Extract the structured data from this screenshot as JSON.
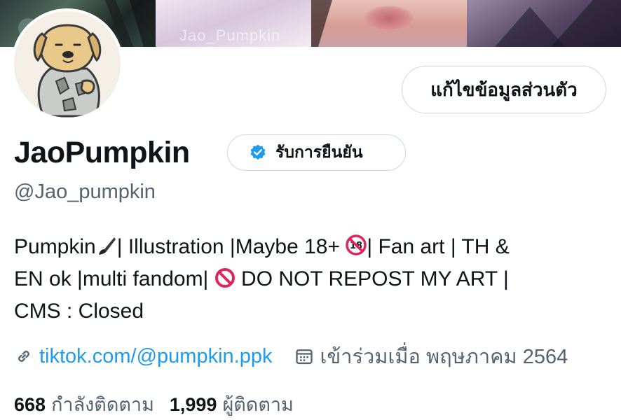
{
  "banner": {
    "watermark": "Jao_Pumpkin"
  },
  "profile": {
    "edit_button": "แก้ไขข้อมูลส่วนตัว",
    "name": "JaoPumpkin",
    "verified_label": "รับการยืนยัน",
    "handle": "@Jao_pumpkin",
    "bio": {
      "line1_a": "Pumpkin",
      "line1_b": "| Illustration |Maybe 18+",
      "line1_c": "| Fan art | TH &",
      "line2_a": "EN ok |multi fandom|",
      "line2_b": "DO NOT REPOST MY ART |",
      "line3": "CMS : Closed"
    },
    "link": "tiktok.com/@pumpkin.ppk",
    "joined": "เข้าร่วมเมื่อ พฤษภาคม 2564",
    "following_count": "668",
    "following_label": "กำลังติดตาม",
    "followers_count": "1,999",
    "followers_label": "ผู้ติดตาม"
  },
  "colors": {
    "link": "#1d9bf0",
    "verified": "#1d9bf0",
    "secondary_text": "#536471",
    "border": "#cfd9de"
  }
}
